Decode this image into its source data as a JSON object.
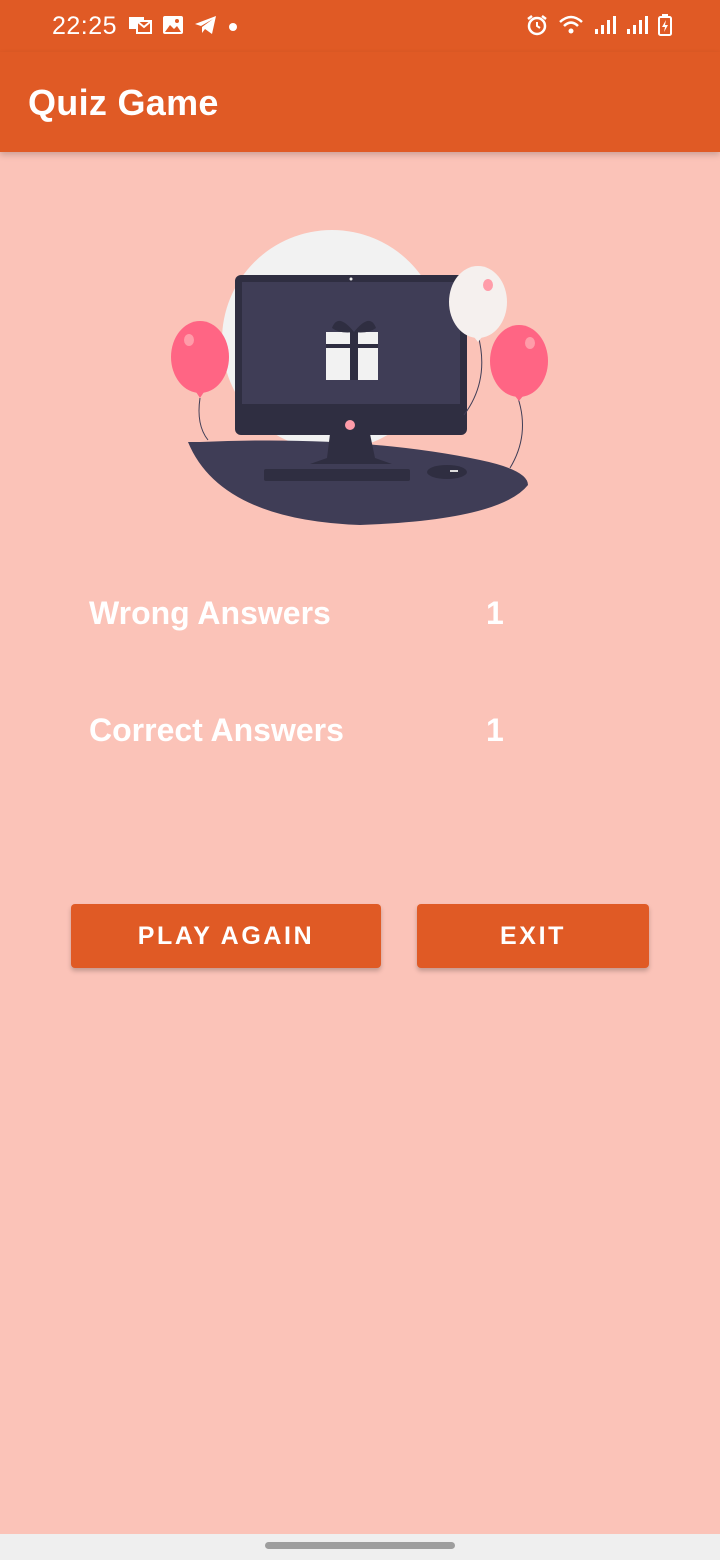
{
  "status_bar": {
    "time": "22:25",
    "left_icons": [
      "mail-notification-icon",
      "image-notification-icon",
      "telegram-icon",
      "dot-icon"
    ],
    "right_icons": [
      "alarm-icon",
      "wifi-icon",
      "signal-icon",
      "signal-icon",
      "battery-icon"
    ]
  },
  "app_bar": {
    "title": "Quiz Game"
  },
  "illustration": {
    "name": "computer-gift-balloons-illustration"
  },
  "results": {
    "wrong_label": "Wrong Answers",
    "wrong_value": "1",
    "correct_label": "Correct Answers",
    "correct_value": "1"
  },
  "buttons": {
    "play_again": "PLAY AGAIN",
    "exit": "EXIT"
  },
  "colors": {
    "primary": "#E05A25",
    "background": "#FBC3B8",
    "text": "#FFFFFF",
    "balloon": "#FF6584",
    "monitor": "#3F3D56"
  }
}
